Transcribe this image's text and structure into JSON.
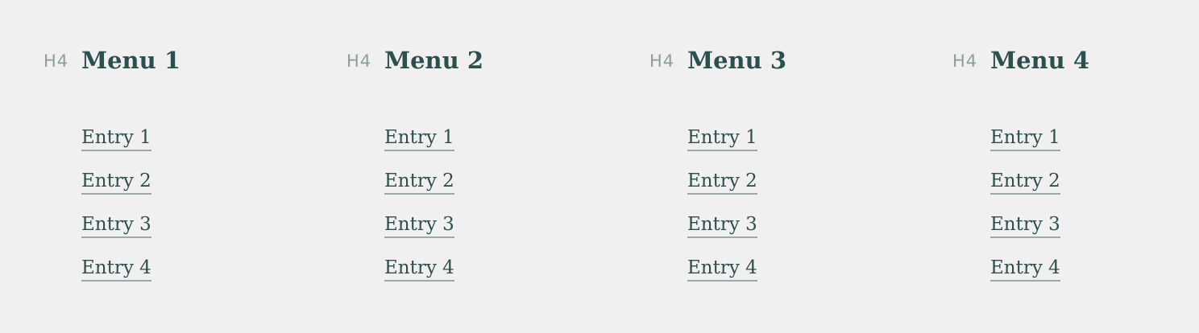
{
  "menus": [
    {
      "tag": "H4",
      "title": "Menu 1",
      "entries": [
        "Entry 1",
        "Entry 2",
        "Entry 3",
        "Entry 4"
      ]
    },
    {
      "tag": "H4",
      "title": "Menu 2",
      "entries": [
        "Entry 1",
        "Entry 2",
        "Entry 3",
        "Entry 4"
      ]
    },
    {
      "tag": "H4",
      "title": "Menu 3",
      "entries": [
        "Entry 1",
        "Entry 2",
        "Entry 3",
        "Entry 4"
      ]
    },
    {
      "tag": "H4",
      "title": "Menu 4",
      "entries": [
        "Entry 1",
        "Entry 2",
        "Entry 3",
        "Entry 4"
      ]
    }
  ],
  "colors": {
    "background": "#f0f0f0",
    "heading": "#2d4f4f",
    "tag": "#8e9d9d",
    "link_underline": "#9aa9a9"
  }
}
